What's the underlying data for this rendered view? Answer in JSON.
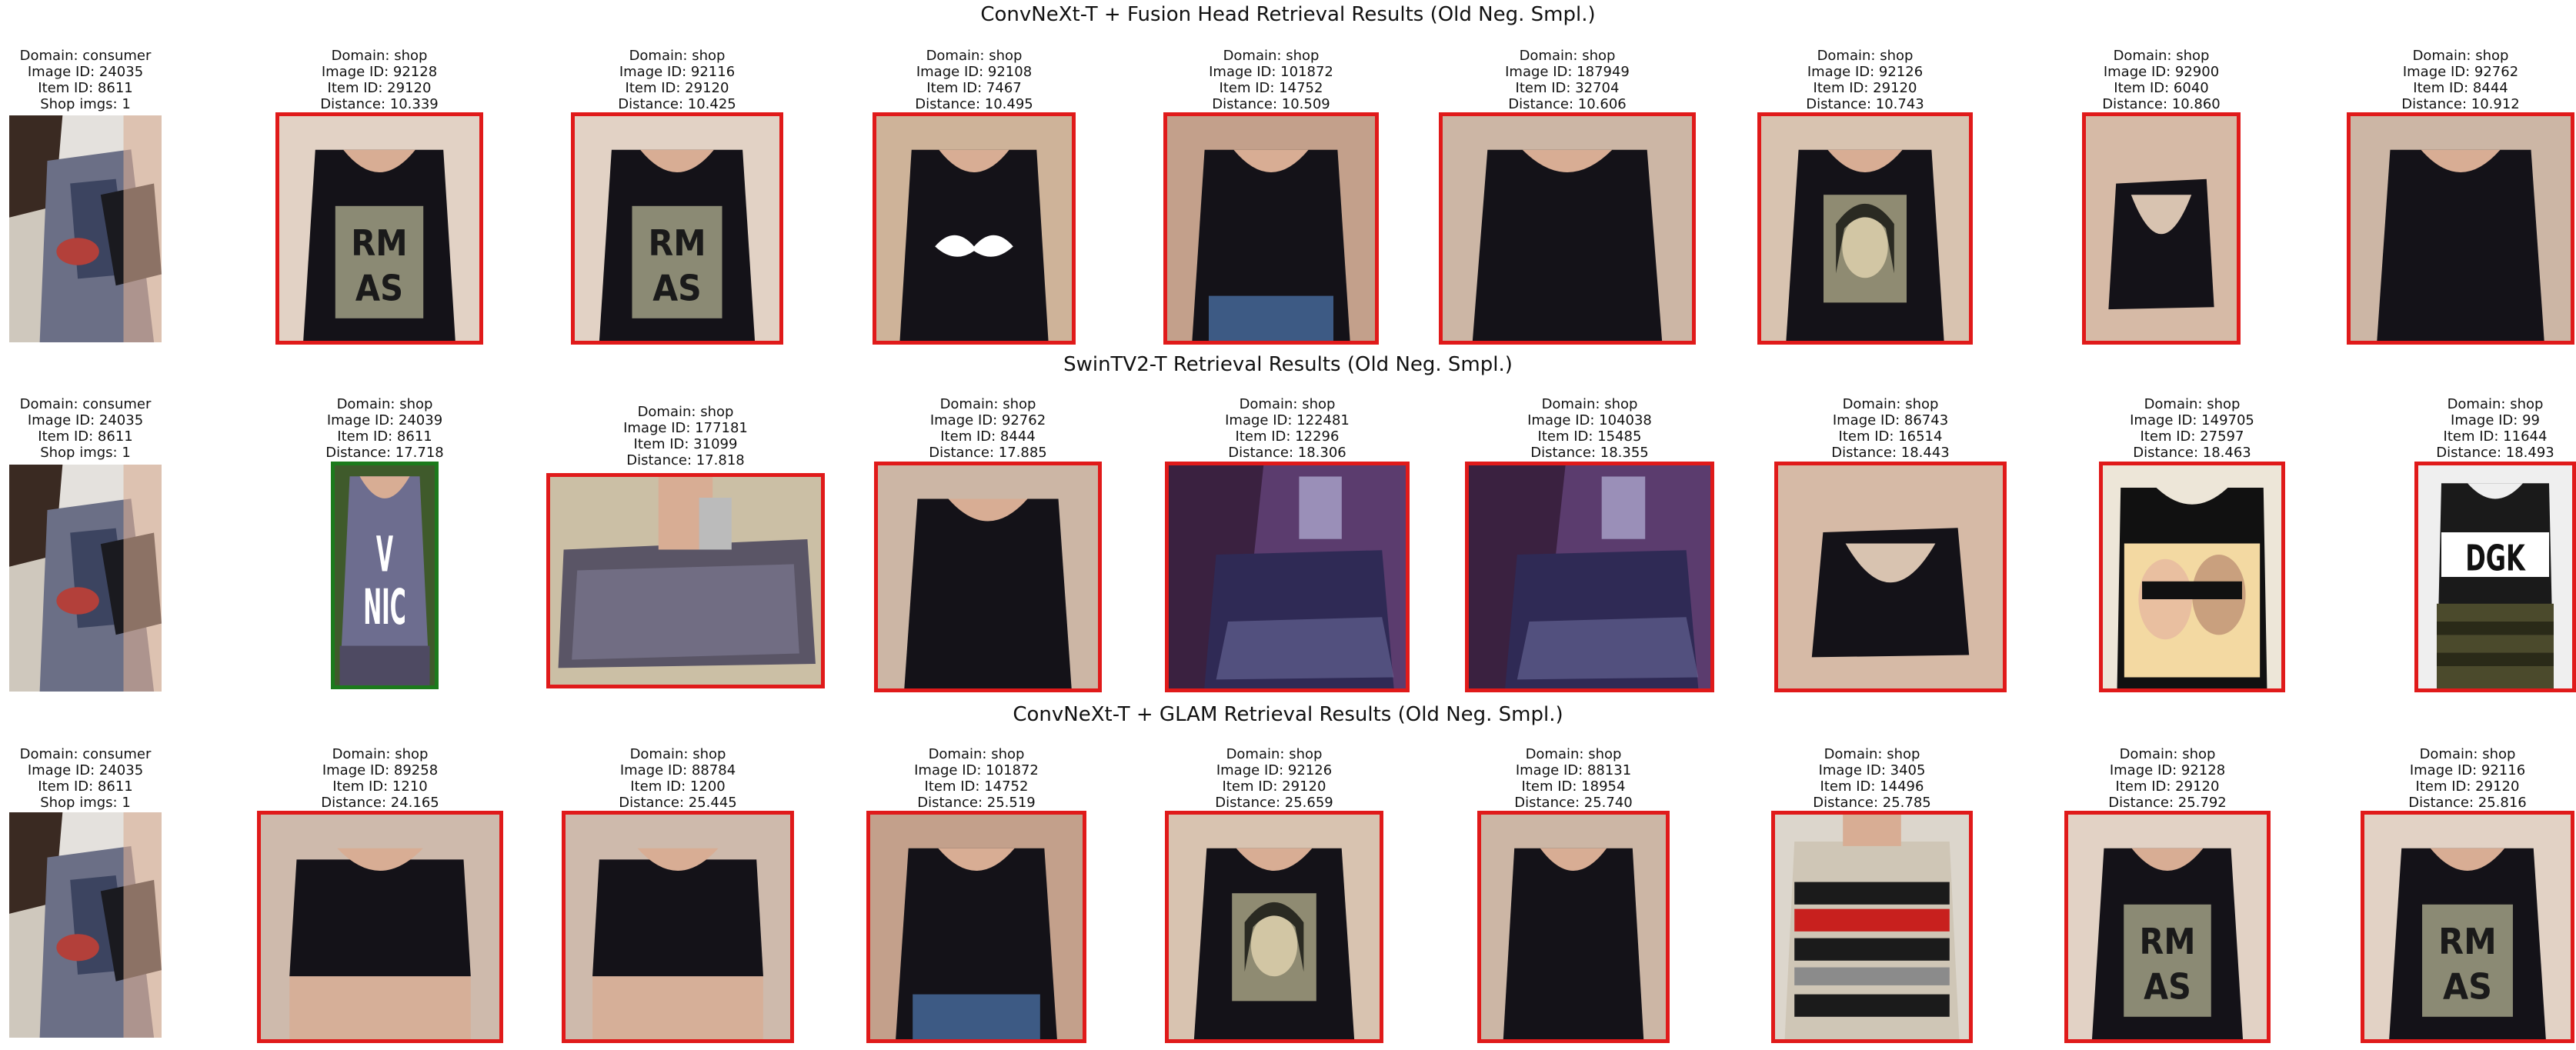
{
  "rows": [
    {
      "title": "ConvNeXt-T + Fusion Head Retrieval Results (Old Neg. Smpl.)",
      "items": [
        {
          "lines": [
            "Domain: consumer",
            "Image ID: 24035",
            "Item ID: 8611",
            "Shop imgs: 1"
          ],
          "kind": "query",
          "match": "none",
          "image": "query-selfie"
        },
        {
          "lines": [
            "Domain: shop",
            "Image ID: 92128",
            "Item ID: 29120",
            "Distance: 10.339"
          ],
          "kind": "result",
          "match": "incorrect",
          "image": "tank-graphic"
        },
        {
          "lines": [
            "Domain: shop",
            "Image ID: 92116",
            "Item ID: 29120",
            "Distance: 10.425"
          ],
          "kind": "result",
          "match": "incorrect",
          "image": "tank-graphic"
        },
        {
          "lines": [
            "Domain: shop",
            "Image ID: 92108",
            "Item ID: 7467",
            "Distance: 10.495"
          ],
          "kind": "result",
          "match": "incorrect",
          "image": "tank-mustache"
        },
        {
          "lines": [
            "Domain: shop",
            "Image ID: 101872",
            "Item ID: 14752",
            "Distance: 10.509"
          ],
          "kind": "result",
          "match": "incorrect",
          "image": "black-tee"
        },
        {
          "lines": [
            "Domain: shop",
            "Image ID: 187949",
            "Item ID: 32704",
            "Distance: 10.606"
          ],
          "kind": "result",
          "match": "incorrect",
          "image": "black-top"
        },
        {
          "lines": [
            "Domain: shop",
            "Image ID: 92126",
            "Item ID: 29120",
            "Distance: 10.743"
          ],
          "kind": "result",
          "match": "incorrect",
          "image": "tank-portrait"
        },
        {
          "lines": [
            "Domain: shop",
            "Image ID: 92900",
            "Item ID: 6040",
            "Distance: 10.860"
          ],
          "kind": "result",
          "match": "incorrect",
          "image": "black-back"
        },
        {
          "lines": [
            "Domain: shop",
            "Image ID: 92762",
            "Item ID: 8444",
            "Distance: 10.912"
          ],
          "kind": "result",
          "match": "incorrect",
          "image": "black-top"
        }
      ]
    },
    {
      "title": "SwinTV2-T Retrieval Results (Old Neg. Smpl.)",
      "items": [
        {
          "lines": [
            "Domain: consumer",
            "Image ID: 24035",
            "Item ID: 8611",
            "Shop imgs: 1"
          ],
          "kind": "query",
          "match": "none",
          "image": "query-selfie"
        },
        {
          "lines": [
            "Domain: shop",
            "Image ID: 24039",
            "Item ID: 8611",
            "Distance: 17.718"
          ],
          "kind": "result",
          "match": "correct",
          "image": "patterned-tank"
        },
        {
          "lines": [
            "Domain: shop",
            "Image ID: 177181",
            "Item ID: 31099",
            "Distance: 17.818"
          ],
          "kind": "result",
          "match": "incorrect",
          "image": "patterned-top"
        },
        {
          "lines": [
            "Domain: shop",
            "Image ID: 92762",
            "Item ID: 8444",
            "Distance: 17.885"
          ],
          "kind": "result",
          "match": "incorrect",
          "image": "black-top"
        },
        {
          "lines": [
            "Domain: shop",
            "Image ID: 122481",
            "Item ID: 12296",
            "Distance: 18.306"
          ],
          "kind": "result",
          "match": "incorrect",
          "image": "purple-top"
        },
        {
          "lines": [
            "Domain: shop",
            "Image ID: 104038",
            "Item ID: 15485",
            "Distance: 18.355"
          ],
          "kind": "result",
          "match": "incorrect",
          "image": "purple-top"
        },
        {
          "lines": [
            "Domain: shop",
            "Image ID: 86743",
            "Item ID: 16514",
            "Distance: 18.443"
          ],
          "kind": "result",
          "match": "incorrect",
          "image": "black-back"
        },
        {
          "lines": [
            "Domain: shop",
            "Image ID: 149705",
            "Item ID: 27597",
            "Distance: 18.463"
          ],
          "kind": "result",
          "match": "incorrect",
          "image": "graphic-tank"
        },
        {
          "lines": [
            "Domain: shop",
            "Image ID: 99",
            "Item ID: 11644",
            "Distance: 18.493"
          ],
          "kind": "result",
          "match": "incorrect",
          "image": "dgk-tank"
        }
      ]
    },
    {
      "title": "ConvNeXt-T + GLAM Retrieval Results (Old Neg. Smpl.)",
      "items": [
        {
          "lines": [
            "Domain: consumer",
            "Image ID: 24035",
            "Item ID: 8611",
            "Shop imgs: 1"
          ],
          "kind": "query",
          "match": "none",
          "image": "query-selfie"
        },
        {
          "lines": [
            "Domain: shop",
            "Image ID: 89258",
            "Item ID: 1210",
            "Distance: 24.165"
          ],
          "kind": "result",
          "match": "incorrect",
          "image": "crop-top"
        },
        {
          "lines": [
            "Domain: shop",
            "Image ID: 88784",
            "Item ID: 1200",
            "Distance: 25.445"
          ],
          "kind": "result",
          "match": "incorrect",
          "image": "crop-top"
        },
        {
          "lines": [
            "Domain: shop",
            "Image ID: 101872",
            "Item ID: 14752",
            "Distance: 25.519"
          ],
          "kind": "result",
          "match": "incorrect",
          "image": "black-tee"
        },
        {
          "lines": [
            "Domain: shop",
            "Image ID: 92126",
            "Item ID: 29120",
            "Distance: 25.659"
          ],
          "kind": "result",
          "match": "incorrect",
          "image": "tank-portrait"
        },
        {
          "lines": [
            "Domain: shop",
            "Image ID: 88131",
            "Item ID: 18954",
            "Distance: 25.740"
          ],
          "kind": "result",
          "match": "incorrect",
          "image": "black-top"
        },
        {
          "lines": [
            "Domain: shop",
            "Image ID: 3405",
            "Item ID: 14496",
            "Distance: 25.785"
          ],
          "kind": "result",
          "match": "incorrect",
          "image": "striped-tee"
        },
        {
          "lines": [
            "Domain: shop",
            "Image ID: 92128",
            "Item ID: 29120",
            "Distance: 25.792"
          ],
          "kind": "result",
          "match": "incorrect",
          "image": "tank-graphic"
        },
        {
          "lines": [
            "Domain: shop",
            "Image ID: 92116",
            "Item ID: 29120",
            "Distance: 25.816"
          ],
          "kind": "result",
          "match": "incorrect",
          "image": "tank-graphic"
        }
      ]
    }
  ],
  "colors": {
    "correct": "#1c7a1c",
    "incorrect": "#e01a1a"
  }
}
